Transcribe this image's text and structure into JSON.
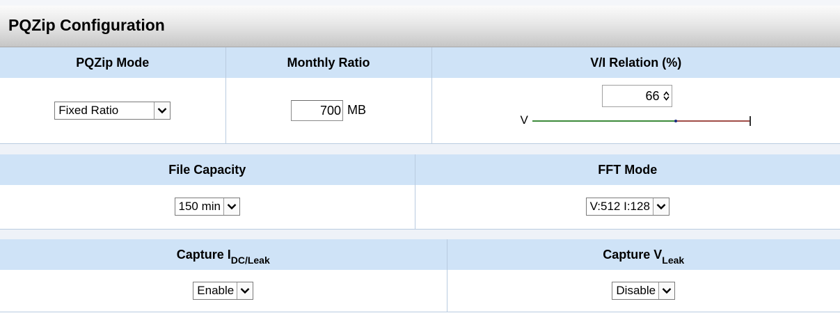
{
  "title": "PQZip Configuration",
  "row1": {
    "mode": {
      "header": "PQZip Mode",
      "value": "Fixed Ratio"
    },
    "monthly": {
      "header": "Monthly Ratio",
      "value": "700",
      "unit": "MB"
    },
    "relation": {
      "header": "V/I Relation (%)",
      "value": "66",
      "slider_left_label": "V",
      "slider_level_percent": 66,
      "colors": {
        "v_side": "#3c8a3a",
        "i_side": "#a04c46"
      }
    }
  },
  "row2": {
    "file_capacity": {
      "header": "File Capacity",
      "value": "150 min"
    },
    "fft_mode": {
      "header": "FFT Mode",
      "value": "V:512 I:128"
    }
  },
  "row3": {
    "capture_idc": {
      "header_main": "Capture I",
      "header_sub": "DC/Leak",
      "value": "Enable"
    },
    "capture_v": {
      "header_main": "Capture V",
      "header_sub": "Leak",
      "value": "Disable"
    }
  },
  "icons": {
    "dropdown": "chevron-down-icon",
    "spinner_up": "caret-up-icon",
    "spinner_down": "caret-down-icon"
  }
}
